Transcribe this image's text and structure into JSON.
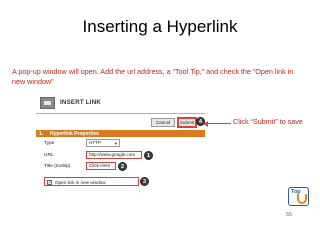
{
  "slide": {
    "title": "Inserting a Hyperlink",
    "instructions": "A pop-up window will open. Add the url address, a “Tool Tip,” and check the “Open link in new window”",
    "callout": "Click “Submit” to save",
    "page_number": "55",
    "logo_text": "Top"
  },
  "dialog": {
    "header_title": "INSERT LINK",
    "cancel_label": "Cancel",
    "submit_label": "Submit",
    "section_number": "1.",
    "section_title": "Hyperlink Properties",
    "type_label": "Type",
    "type_value": "HTTP",
    "url_label": "URL",
    "url_value": "http://www.google.com",
    "title_label": "Title (tooltip)",
    "title_value": "Click Here",
    "checkbox_label": "Open link in new window",
    "checkbox_mark": "✓"
  },
  "markers": {
    "submit": "4",
    "url": "1",
    "title": "2",
    "checkbox": "3"
  },
  "colors": {
    "accent_text": "#b22b1e",
    "highlight": "#d0473a",
    "section_bar": "#d97a1f"
  }
}
